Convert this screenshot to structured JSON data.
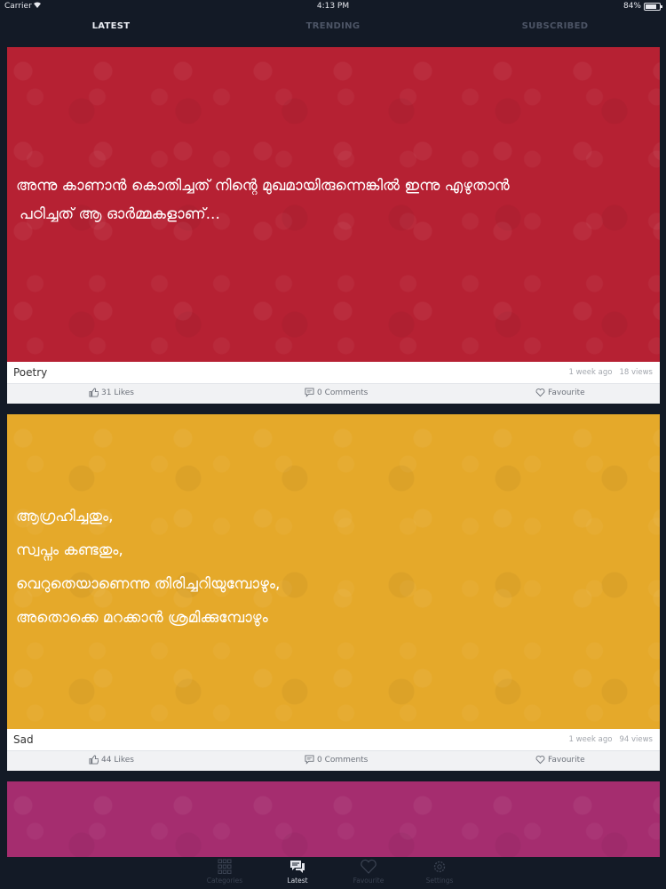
{
  "status": {
    "carrier": "Carrier",
    "time": "4:13 PM",
    "battery": "84%",
    "battery_level": 0.84
  },
  "tabs": [
    {
      "label": "LATEST",
      "active": true
    },
    {
      "label": "TRENDING",
      "active": false
    },
    {
      "label": "SUBSCRIBED",
      "active": false
    }
  ],
  "posts": [
    {
      "color": "#b62133",
      "lines": [
        "അന്നു കാണാൻ കൊതിച്ചത് നിന്റെ മുഖമായിരുന്നെങ്കിൽ ഇന്നു എഴുതാൻ",
        "പഠിച്ചത് ആ ഓർമ്മകളാണ്..."
      ],
      "category": "Poetry",
      "time_ago": "1 week ago",
      "views": "18 views",
      "likes": "31 Likes",
      "comments": "0 Comments",
      "favourite": "Favourite"
    },
    {
      "color": "#e5a92a",
      "lines": [
        "ആഗ്രഹിച്ചതും,",
        "സ്വപ്നം കണ്ടതും,",
        "വെറുതെയാണെന്നു തിരിച്ചറിയുമ്പോഴും,",
        "അതൊക്കെ മറക്കാൻ ശ്രമിക്കുമ്പോഴും"
      ],
      "category": "Sad",
      "time_ago": "1 week ago",
      "views": "94 views",
      "likes": "44 Likes",
      "comments": "0 Comments",
      "favourite": "Favourite"
    },
    {
      "color": "#a52d6f"
    }
  ],
  "bottom_tabs": [
    {
      "label": "Categories",
      "icon": "grid-icon",
      "active": false
    },
    {
      "label": "Latest",
      "icon": "chat-icon",
      "active": true
    },
    {
      "label": "Favourite",
      "icon": "heart-icon",
      "active": false
    },
    {
      "label": "Settings",
      "icon": "gear-icon",
      "active": false
    }
  ]
}
